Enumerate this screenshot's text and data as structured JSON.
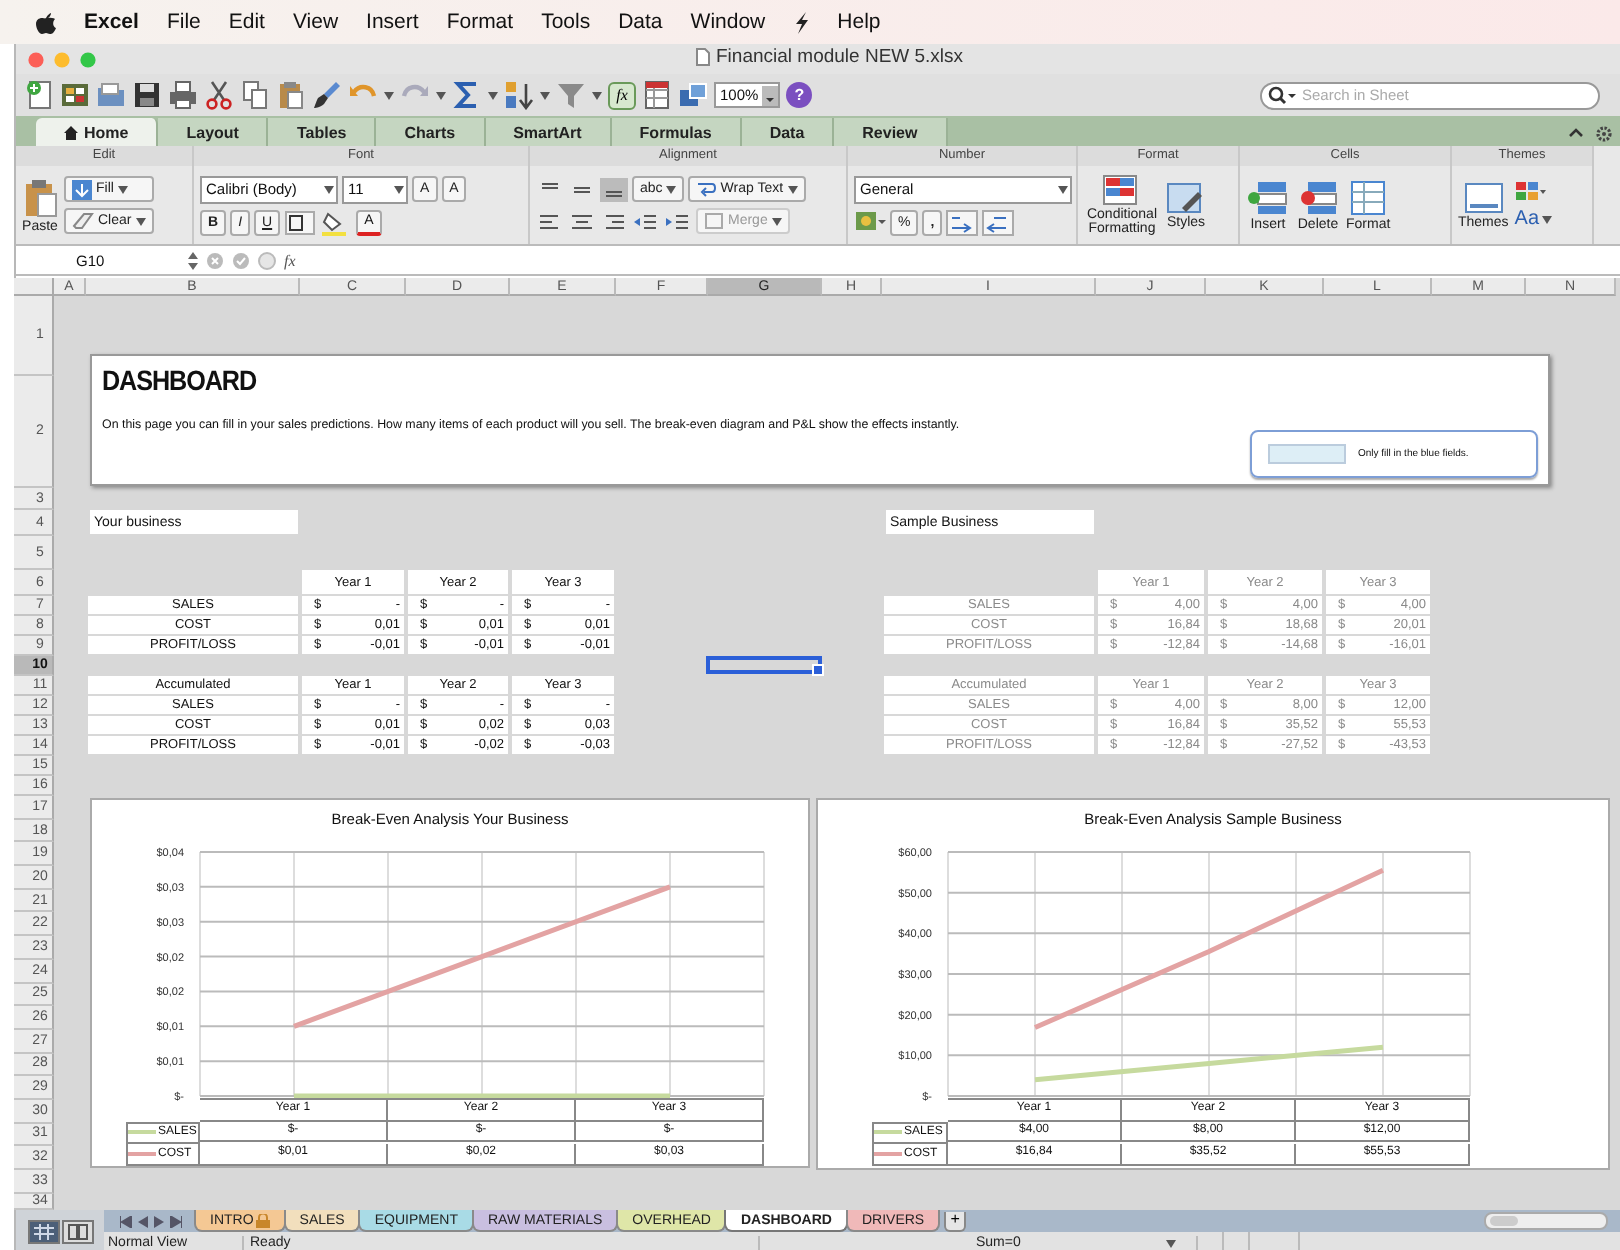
{
  "menu_bar": {
    "items": [
      {
        "label": "Excel",
        "kind": "app"
      },
      {
        "label": "File",
        "kind": "menu"
      },
      {
        "label": "Edit",
        "kind": "menu"
      },
      {
        "label": "View",
        "kind": "menu"
      },
      {
        "label": "Insert",
        "kind": "menu"
      },
      {
        "label": "Format",
        "kind": "menu"
      },
      {
        "label": "Tools",
        "kind": "menu"
      },
      {
        "label": "Data",
        "kind": "menu"
      },
      {
        "label": "Window",
        "kind": "menu"
      },
      {
        "label": "Help",
        "kind": "menu"
      }
    ]
  },
  "window": {
    "title": "Financial module NEW 5.xlsx"
  },
  "toolbar": {
    "formula_button": "fx",
    "zoom": "100%",
    "help": "?",
    "search_placeholder": "Search in Sheet"
  },
  "ribbon_tabs": [
    {
      "label": "Home",
      "selected": true
    },
    {
      "label": "Layout",
      "selected": false
    },
    {
      "label": "Tables",
      "selected": false
    },
    {
      "label": "Charts",
      "selected": false
    },
    {
      "label": "SmartArt",
      "selected": false
    },
    {
      "label": "Formulas",
      "selected": false
    },
    {
      "label": "Data",
      "selected": false
    },
    {
      "label": "Review",
      "selected": false
    }
  ],
  "ribbon": {
    "groups": [
      "Edit",
      "Font",
      "Alignment",
      "Number",
      "Format",
      "Cells",
      "Themes"
    ],
    "paste": "Paste",
    "fill": "Fill",
    "clear": "Clear",
    "font": "Calibri (Body)",
    "font_size": "11",
    "grow_font": "A",
    "shrink_font": "A",
    "bold": "B",
    "italic": "I",
    "underline": "U",
    "font_color": "A",
    "abc": "abc",
    "wrap_text": "Wrap Text",
    "merge": {
      "label": "Merge",
      "disabled": true
    },
    "number_format": "General",
    "percent": "%",
    "comma": ",",
    "conditional": "Conditional Formatting",
    "styles": "Styles",
    "insert": "Insert",
    "delete": "Delete",
    "format": "Format",
    "themes": "Themes",
    "theme_fonts": "Aa"
  },
  "formula_bar": {
    "cell": "G10",
    "fx": "fx"
  },
  "columns": [
    {
      "label": "A",
      "selected": false
    },
    {
      "label": "B",
      "selected": false
    },
    {
      "label": "C",
      "selected": false
    },
    {
      "label": "D",
      "selected": false
    },
    {
      "label": "E",
      "selected": false
    },
    {
      "label": "F",
      "selected": false
    },
    {
      "label": "G",
      "selected": true
    },
    {
      "label": "H",
      "selected": false
    },
    {
      "label": "I",
      "selected": false
    },
    {
      "label": "J",
      "selected": false
    },
    {
      "label": "K",
      "selected": false
    },
    {
      "label": "L",
      "selected": false
    },
    {
      "label": "M",
      "selected": false
    },
    {
      "label": "N",
      "selected": false
    }
  ],
  "rows": [
    {
      "label": "1",
      "selected": false
    },
    {
      "label": "2",
      "selected": false
    },
    {
      "label": "3",
      "selected": false
    },
    {
      "label": "4",
      "selected": false
    },
    {
      "label": "5",
      "selected": false
    },
    {
      "label": "6",
      "selected": false
    },
    {
      "label": "7",
      "selected": false
    },
    {
      "label": "8",
      "selected": false
    },
    {
      "label": "9",
      "selected": false
    },
    {
      "label": "10",
      "selected": true
    },
    {
      "label": "11",
      "selected": false
    },
    {
      "label": "12",
      "selected": false
    },
    {
      "label": "13",
      "selected": false
    },
    {
      "label": "14",
      "selected": false
    },
    {
      "label": "15",
      "selected": false
    },
    {
      "label": "16",
      "selected": false
    },
    {
      "label": "17",
      "selected": false
    },
    {
      "label": "18",
      "selected": false
    },
    {
      "label": "19",
      "selected": false
    },
    {
      "label": "20",
      "selected": false
    },
    {
      "label": "21",
      "selected": false
    },
    {
      "label": "22",
      "selected": false
    },
    {
      "label": "23",
      "selected": false
    },
    {
      "label": "24",
      "selected": false
    },
    {
      "label": "25",
      "selected": false
    },
    {
      "label": "26",
      "selected": false
    },
    {
      "label": "27",
      "selected": false
    },
    {
      "label": "28",
      "selected": false
    },
    {
      "label": "29",
      "selected": false
    },
    {
      "label": "30",
      "selected": false
    },
    {
      "label": "31",
      "selected": false
    },
    {
      "label": "32",
      "selected": false
    },
    {
      "label": "33",
      "selected": false
    },
    {
      "label": "34",
      "selected": false
    }
  ],
  "dashboard": {
    "title": "DASHBOARD",
    "description": "On this page you can fill in your sales predictions. How many items of each product will you sell. The break-even diagram and P&L show the effects instantly.",
    "note": "Only fill in the blue fields."
  },
  "sections": [
    {
      "title": "Your business",
      "muted": false,
      "tables": [
        {
          "headers": [
            "Year 1",
            "Year 2",
            "Year 3"
          ],
          "rows": [
            {
              "label": "SALES",
              "cells": [
                {
                  "currency": "$",
                  "value": "-"
                },
                {
                  "currency": "$",
                  "value": "-"
                },
                {
                  "currency": "$",
                  "value": "-"
                }
              ]
            },
            {
              "label": "COST",
              "cells": [
                {
                  "currency": "$",
                  "value": "0,01"
                },
                {
                  "currency": "$",
                  "value": "0,01"
                },
                {
                  "currency": "$",
                  "value": "0,01"
                }
              ]
            },
            {
              "label": "PROFIT/LOSS",
              "cells": [
                {
                  "currency": "$",
                  "value": "-0,01"
                },
                {
                  "currency": "$",
                  "value": "-0,01"
                },
                {
                  "currency": "$",
                  "value": "-0,01"
                }
              ]
            }
          ]
        },
        {
          "label": "Accumulated",
          "headers": [
            "Year 1",
            "Year 2",
            "Year 3"
          ],
          "rows": [
            {
              "label": "SALES",
              "cells": [
                {
                  "currency": "$",
                  "value": "-"
                },
                {
                  "currency": "$",
                  "value": "-"
                },
                {
                  "currency": "$",
                  "value": "-"
                }
              ]
            },
            {
              "label": "COST",
              "cells": [
                {
                  "currency": "$",
                  "value": "0,01"
                },
                {
                  "currency": "$",
                  "value": "0,02"
                },
                {
                  "currency": "$",
                  "value": "0,03"
                }
              ]
            },
            {
              "label": "PROFIT/LOSS",
              "cells": [
                {
                  "currency": "$",
                  "value": "-0,01"
                },
                {
                  "currency": "$",
                  "value": "-0,02"
                },
                {
                  "currency": "$",
                  "value": "-0,03"
                }
              ]
            }
          ]
        }
      ]
    },
    {
      "title": "Sample Business",
      "muted": true,
      "tables": [
        {
          "headers": [
            "Year 1",
            "Year 2",
            "Year 3"
          ],
          "rows": [
            {
              "label": "SALES",
              "cells": [
                {
                  "currency": "$",
                  "value": "4,00"
                },
                {
                  "currency": "$",
                  "value": "4,00"
                },
                {
                  "currency": "$",
                  "value": "4,00"
                }
              ]
            },
            {
              "label": "COST",
              "cells": [
                {
                  "currency": "$",
                  "value": "16,84"
                },
                {
                  "currency": "$",
                  "value": "18,68"
                },
                {
                  "currency": "$",
                  "value": "20,01"
                }
              ]
            },
            {
              "label": "PROFIT/LOSS",
              "cells": [
                {
                  "currency": "$",
                  "value": "-12,84"
                },
                {
                  "currency": "$",
                  "value": "-14,68"
                },
                {
                  "currency": "$",
                  "value": "-16,01"
                }
              ]
            }
          ]
        },
        {
          "label": "Accumulated",
          "headers": [
            "Year 1",
            "Year 2",
            "Year 3"
          ],
          "rows": [
            {
              "label": "SALES",
              "cells": [
                {
                  "currency": "$",
                  "value": "4,00"
                },
                {
                  "currency": "$",
                  "value": "8,00"
                },
                {
                  "currency": "$",
                  "value": "12,00"
                }
              ]
            },
            {
              "label": "COST",
              "cells": [
                {
                  "currency": "$",
                  "value": "16,84"
                },
                {
                  "currency": "$",
                  "value": "35,52"
                },
                {
                  "currency": "$",
                  "value": "55,53"
                }
              ]
            },
            {
              "label": "PROFIT/LOSS",
              "cells": [
                {
                  "currency": "$",
                  "value": "-12,84"
                },
                {
                  "currency": "$",
                  "value": "-27,52"
                },
                {
                  "currency": "$",
                  "value": "-43,53"
                }
              ]
            }
          ]
        }
      ]
    }
  ],
  "charts": [
    {
      "chart_data": {
        "type": "line",
        "title": "Break-Even Analysis Your Business",
        "categories": [
          "Year 1",
          "Year 2",
          "Year 3"
        ],
        "series": [
          {
            "name": "SALES",
            "color": "#c6da9e",
            "values": [
              0,
              0,
              0
            ]
          },
          {
            "name": "COST",
            "color": "#e3a3a3",
            "values": [
              0.01,
              0.02,
              0.03
            ]
          }
        ],
        "grid": true,
        "legend": true,
        "ylim": [
          0,
          0.035
        ],
        "yticks": [
          {
            "value": 0,
            "label": "$-"
          },
          {
            "value": 0.005,
            "label": "$0,01"
          },
          {
            "value": 0.01,
            "label": "$0,01"
          },
          {
            "value": 0.015,
            "label": "$0,02"
          },
          {
            "value": 0.02,
            "label": "$0,02"
          },
          {
            "value": 0.025,
            "label": "$0,03"
          },
          {
            "value": 0.03,
            "label": "$0,03"
          },
          {
            "value": 0.035,
            "label": "$0,04"
          }
        ]
      },
      "table_values": [
        [
          "$-",
          "$-",
          "$-"
        ],
        [
          "$0,01",
          "$0,02",
          "$0,03"
        ]
      ]
    },
    {
      "chart_data": {
        "type": "line",
        "title": "Break-Even Analysis Sample Business",
        "categories": [
          "Year 1",
          "Year 2",
          "Year 3"
        ],
        "series": [
          {
            "name": "SALES",
            "color": "#c6da9e",
            "values": [
              4,
              8,
              12
            ]
          },
          {
            "name": "COST",
            "color": "#e3a3a3",
            "values": [
              16.84,
              35.52,
              55.53
            ]
          }
        ],
        "grid": true,
        "legend": true,
        "ylim": [
          0,
          60
        ],
        "yticks": [
          {
            "value": 0,
            "label": "$-"
          },
          {
            "value": 10,
            "label": "$10,00"
          },
          {
            "value": 20,
            "label": "$20,00"
          },
          {
            "value": 30,
            "label": "$30,00"
          },
          {
            "value": 40,
            "label": "$40,00"
          },
          {
            "value": 50,
            "label": "$50,00"
          },
          {
            "value": 60,
            "label": "$60,00"
          }
        ]
      },
      "table_values": [
        [
          "$4,00",
          "$8,00",
          "$12,00"
        ],
        [
          "$16,84",
          "$35,52",
          "$55,53"
        ]
      ]
    }
  ],
  "sheet_tabs": [
    {
      "label": "INTRO",
      "color": "#f4c894",
      "selected": false,
      "locked": true
    },
    {
      "label": "SALES",
      "color": "#f2dfbd",
      "selected": false,
      "locked": false
    },
    {
      "label": "EQUIPMENT",
      "color": "#a9dbe6",
      "selected": false,
      "locked": false
    },
    {
      "label": "RAW MATERIALS",
      "color": "#c9bfe0",
      "selected": false,
      "locked": false
    },
    {
      "label": "OVERHEAD",
      "color": "#dfe6a8",
      "selected": false,
      "locked": false
    },
    {
      "label": "DASHBOARD",
      "color": "#ffffff",
      "selected": true,
      "locked": false
    },
    {
      "label": "DRIVERS",
      "color": "#f0b9b9",
      "selected": false,
      "locked": false
    }
  ],
  "add_sheet": "+",
  "status_bar": {
    "view": "Normal View",
    "state": "Ready",
    "sum": "Sum=0"
  }
}
